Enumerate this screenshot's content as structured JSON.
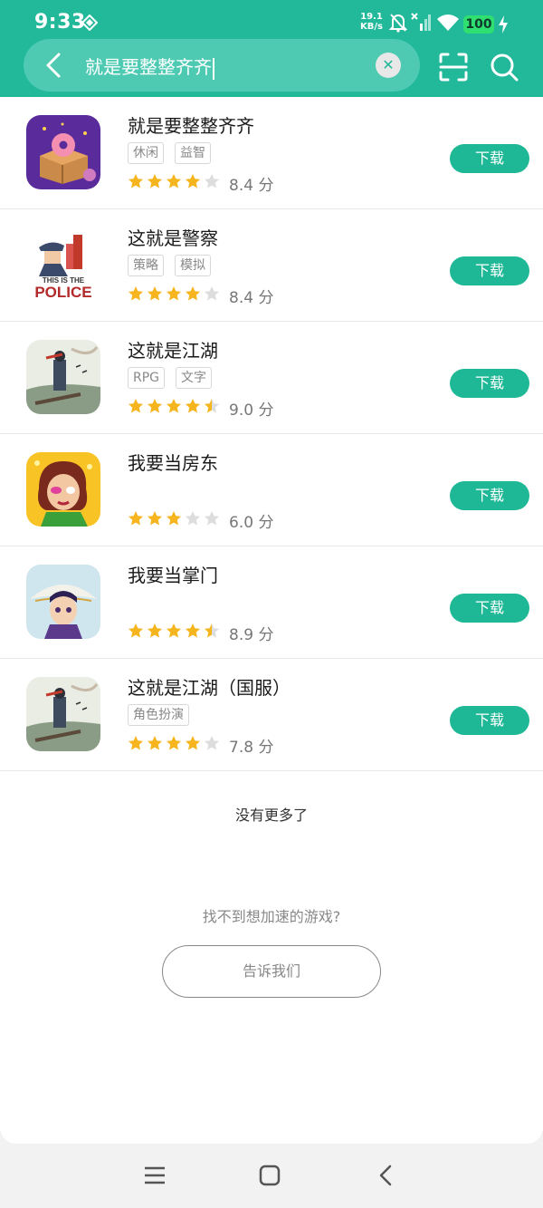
{
  "status": {
    "time": "9:33",
    "net_speed_value": "19.1",
    "net_speed_unit": "KB/s",
    "battery": "100"
  },
  "search": {
    "query": "就是要整整齐齐"
  },
  "colors": {
    "accent": "#22b89a",
    "button": "#1fb897",
    "star_filled": "#f6b51e",
    "star_empty": "#dddddd"
  },
  "apps": [
    {
      "name": "就是要整整齐齐",
      "tags": [
        "休闲",
        "益智"
      ],
      "rating": 4,
      "score": "8.4 分",
      "button": "下载",
      "icon": "donut-box-game-icon"
    },
    {
      "name": "这就是警察",
      "tags": [
        "策略",
        "模拟"
      ],
      "rating": 4,
      "score": "8.4 分",
      "button": "下载",
      "icon": "police-game-icon",
      "icon_text_1": "THIS IS THE",
      "icon_text_2": "POLICE"
    },
    {
      "name": "这就是江湖",
      "tags": [
        "RPG",
        "文字"
      ],
      "rating": 4.5,
      "score": "9.0 分",
      "button": "下载",
      "icon": "jianghu-game-icon"
    },
    {
      "name": "我要当房东",
      "tags": [],
      "rating": 3,
      "score": "6.0 分",
      "button": "下载",
      "icon": "landlord-game-icon"
    },
    {
      "name": "我要当掌门",
      "tags": [],
      "rating": 4.5,
      "score": "8.9 分",
      "button": "下载",
      "icon": "sect-master-game-icon"
    },
    {
      "name": "这就是江湖（国服）",
      "tags": [
        "角色扮演"
      ],
      "rating": 4,
      "score": "7.8 分",
      "button": "下载",
      "icon": "jianghu-cn-game-icon"
    }
  ],
  "footer": {
    "no_more": "没有更多了",
    "cant_find": "找不到想加速的游戏?",
    "tell_us": "告诉我们"
  }
}
